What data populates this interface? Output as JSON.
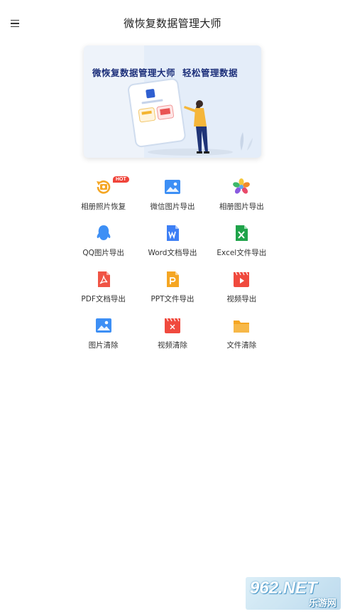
{
  "header": {
    "title": "微恢复数据管理大师",
    "menu_icon": "hamburger-menu-icon"
  },
  "banner": {
    "text_left": "微恢复数据管理大师",
    "text_right": "轻松管理数据"
  },
  "features": [
    {
      "label": "相册照片恢复",
      "icon": "photo-restore-icon",
      "badge": "HOT",
      "color": "#f5a623"
    },
    {
      "label": "微信图片导出",
      "icon": "image-icon",
      "color": "#3d8ff5"
    },
    {
      "label": "相册图片导出",
      "icon": "photos-flower-icon",
      "color": "#f5a623"
    },
    {
      "label": "QQ图片导出",
      "icon": "qq-penguin-icon",
      "color": "#3d8ff5"
    },
    {
      "label": "Word文档导出",
      "icon": "word-doc-icon",
      "color": "#3d7ff5"
    },
    {
      "label": "Excel文件导出",
      "icon": "excel-doc-icon",
      "color": "#1fa34a"
    },
    {
      "label": "PDF文档导出",
      "icon": "pdf-doc-icon",
      "color": "#f05445"
    },
    {
      "label": "PPT文件导出",
      "icon": "ppt-doc-icon",
      "color": "#f5a623"
    },
    {
      "label": "视频导出",
      "icon": "video-clapper-icon",
      "color": "#f04a3e"
    },
    {
      "label": "图片清除",
      "icon": "image-icon",
      "color": "#3d8ff5"
    },
    {
      "label": "视频清除",
      "icon": "video-clapper-icon",
      "color": "#f04a3e"
    },
    {
      "label": "文件清除",
      "icon": "folder-icon",
      "color": "#f5a623"
    }
  ],
  "watermark": {
    "main": "962.NET",
    "sub": "乐游网"
  }
}
